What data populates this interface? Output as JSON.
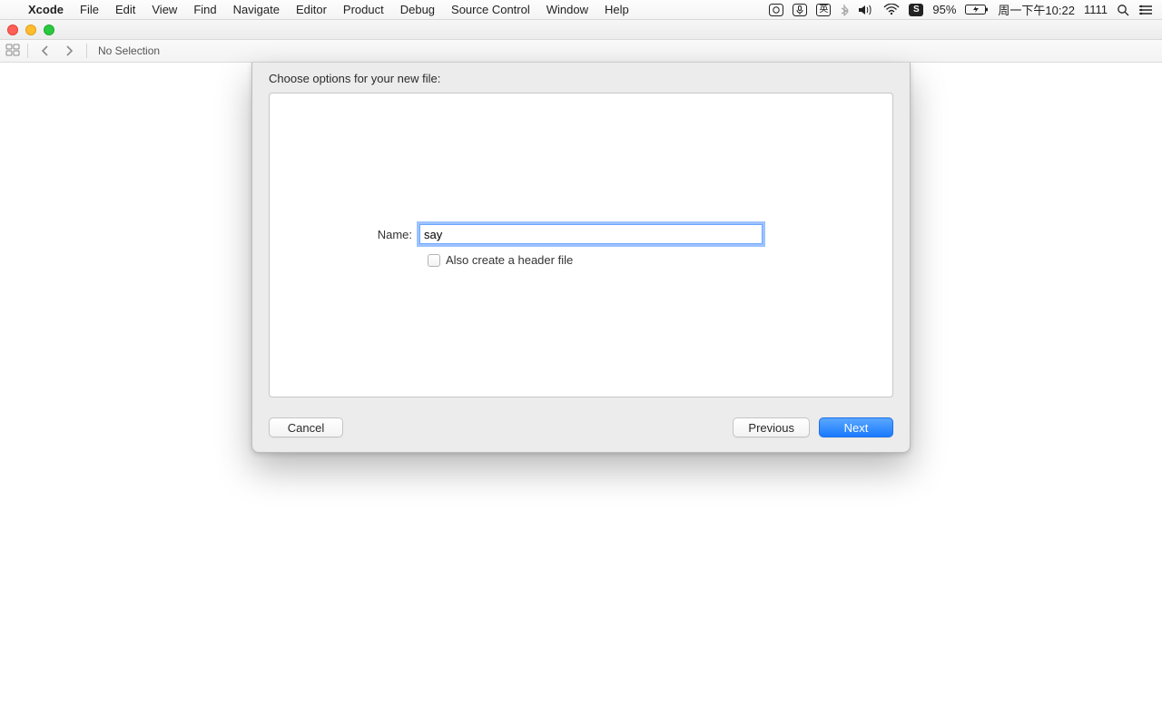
{
  "menubar": {
    "app": "Xcode",
    "items": [
      "File",
      "Edit",
      "View",
      "Find",
      "Navigate",
      "Editor",
      "Product",
      "Debug",
      "Source Control",
      "Window",
      "Help"
    ],
    "status": {
      "battery_pct": "95%",
      "clock": "周一下午10:22",
      "extra": "1111"
    }
  },
  "jumpbar": {
    "text": "No Selection"
  },
  "sheet": {
    "title": "Choose options for your new file:",
    "name_label": "Name:",
    "name_value": "say",
    "also_header_label": "Also create a header file",
    "also_header_checked": false,
    "buttons": {
      "cancel": "Cancel",
      "previous": "Previous",
      "next": "Next"
    }
  }
}
